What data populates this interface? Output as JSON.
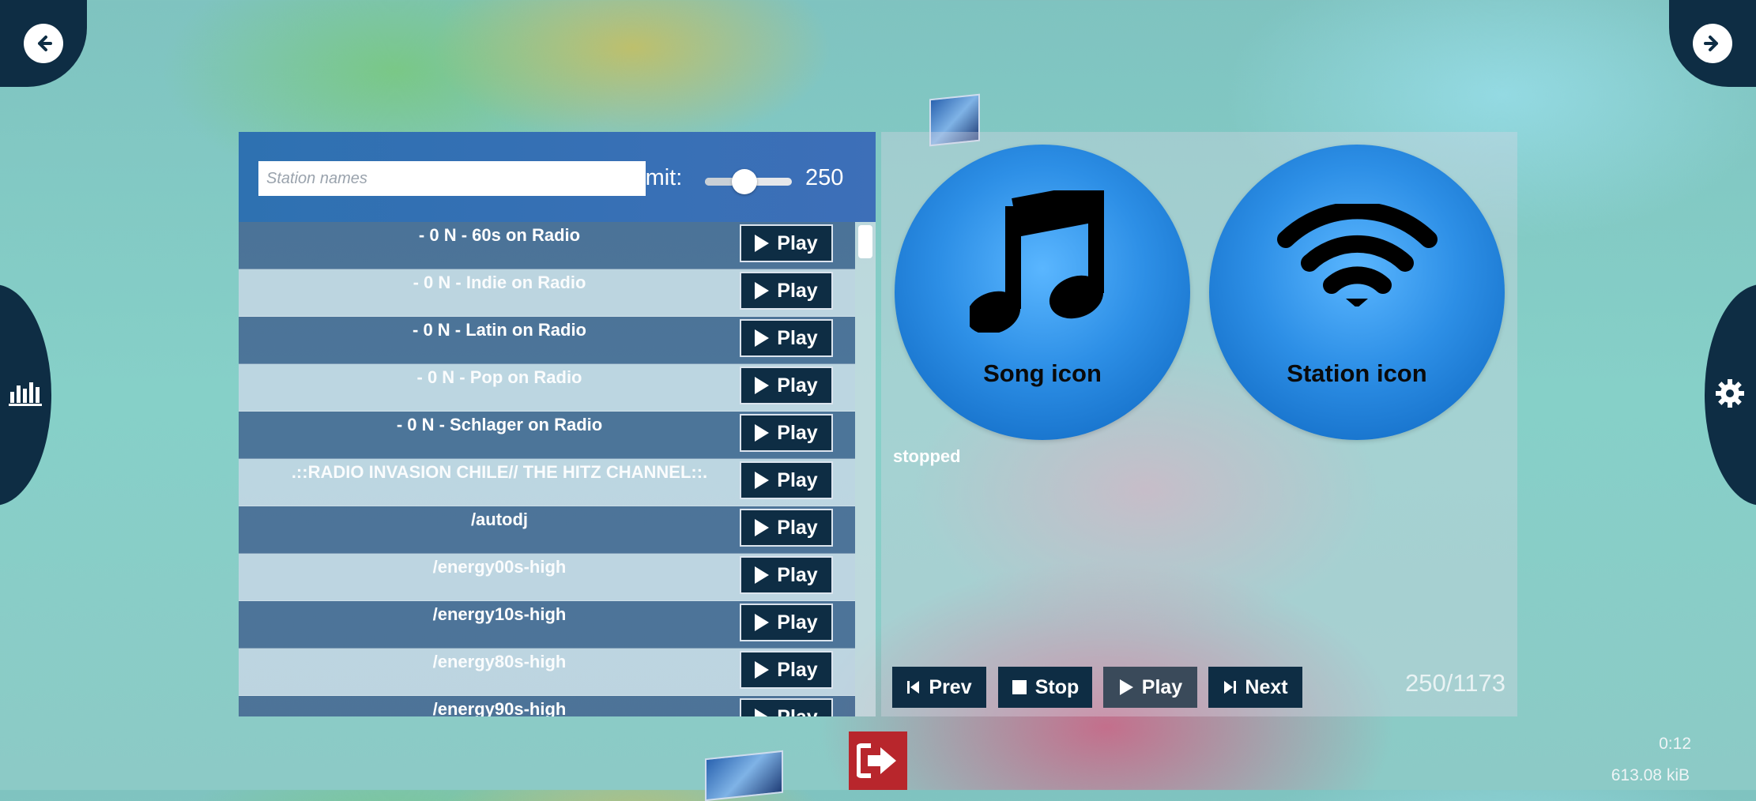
{
  "nav": {
    "back_icon": "arrow-left-circle-icon",
    "forward_icon": "arrow-right-circle-icon",
    "stats_icon": "bar-chart-icon",
    "settings_icon": "gear-icon",
    "logout_icon": "logout-icon"
  },
  "search": {
    "placeholder": "Station names",
    "value": "",
    "limit_label": "Limit:",
    "limit_value": "250",
    "limit_slider_fraction": 0.45
  },
  "stations": [
    {
      "name": "- 0 N - 60s on Radio",
      "button": "Play"
    },
    {
      "name": "- 0 N - Indie on Radio",
      "button": "Play"
    },
    {
      "name": "- 0 N - Latin on Radio",
      "button": "Play"
    },
    {
      "name": "- 0 N - Pop on Radio",
      "button": "Play"
    },
    {
      "name": "- 0 N - Schlager on Radio",
      "button": "Play"
    },
    {
      "name": ".::RADIO INVASION CHILE// THE HITZ CHANNEL::.",
      "button": "Play"
    },
    {
      "name": "/autodj",
      "button": "Play"
    },
    {
      "name": "/energy00s-high",
      "button": "Play"
    },
    {
      "name": "/energy10s-high",
      "button": "Play"
    },
    {
      "name": "/energy80s-high",
      "button": "Play"
    },
    {
      "name": "/energy90s-high",
      "button": "Play"
    }
  ],
  "player": {
    "song_icon_label": "Song icon",
    "station_icon_label": "Station icon",
    "status": "stopped",
    "prev": "Prev",
    "stop": "Stop",
    "play": "Play",
    "next": "Next",
    "counter": "250/1173"
  },
  "footer": {
    "time": "0:12",
    "size": "613.08 kiB"
  },
  "colors": {
    "dark_button": "#0e2d44",
    "header_blue": "#2e71b1",
    "circle_blue": "#2d8fe6",
    "logout_red": "#b8262c"
  }
}
